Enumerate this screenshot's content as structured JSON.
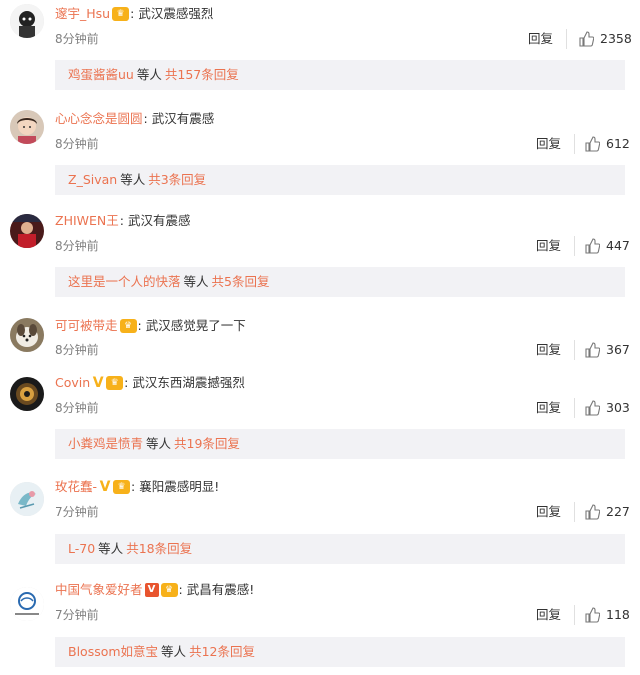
{
  "labels": {
    "reply": "回复"
  },
  "comments": [
    {
      "user": "邃宇_Hsu",
      "text": "武汉震感强烈",
      "time": "8分钟前",
      "likes": "2358",
      "sub_user": "鸡蛋酱酱uu",
      "sub_mid": "等人",
      "sub_count": "共157条回复"
    },
    {
      "user": "心心念念是圆圆",
      "text": "武汉有震感",
      "time": "8分钟前",
      "likes": "612",
      "sub_user": "Z_Sivan",
      "sub_mid": "等人",
      "sub_count": "共3条回复"
    },
    {
      "user": "ZHIWEN王",
      "text": "武汉有震感",
      "time": "8分钟前",
      "likes": "447",
      "sub_user": "这里是一个人的快落",
      "sub_mid": "等人",
      "sub_count": "共5条回复"
    },
    {
      "user": "可可被带走",
      "text": "武汉感觉晃了一下",
      "time": "8分钟前",
      "likes": "367",
      "sub_user": "",
      "sub_mid": "",
      "sub_count": ""
    },
    {
      "user": "Covin",
      "text": "武汉东西湖震撼强烈",
      "time": "8分钟前",
      "likes": "303",
      "sub_user": "小粪鸡是愤青",
      "sub_mid": "等人",
      "sub_count": "共19条回复"
    },
    {
      "user": "玫花蠢-",
      "text": "襄阳震感明显!",
      "time": "7分钟前",
      "likes": "227",
      "sub_user": "L-70",
      "sub_mid": "等人",
      "sub_count": "共18条回复"
    },
    {
      "user": "中国气象爱好者",
      "text": "武昌有震感!",
      "time": "7分钟前",
      "likes": "118",
      "sub_user": "Blossom如意宝",
      "sub_mid": "等人",
      "sub_count": "共12条回复"
    }
  ],
  "colors": {
    "username": "#eb7350",
    "subbox_bg": "#f2f2f5",
    "muted": "#808080",
    "badge": "#f7b11a"
  },
  "icons": {
    "like": "thumbs-up-icon",
    "member_badge": "crown-badge-icon",
    "verified": "v-verified-icon"
  }
}
